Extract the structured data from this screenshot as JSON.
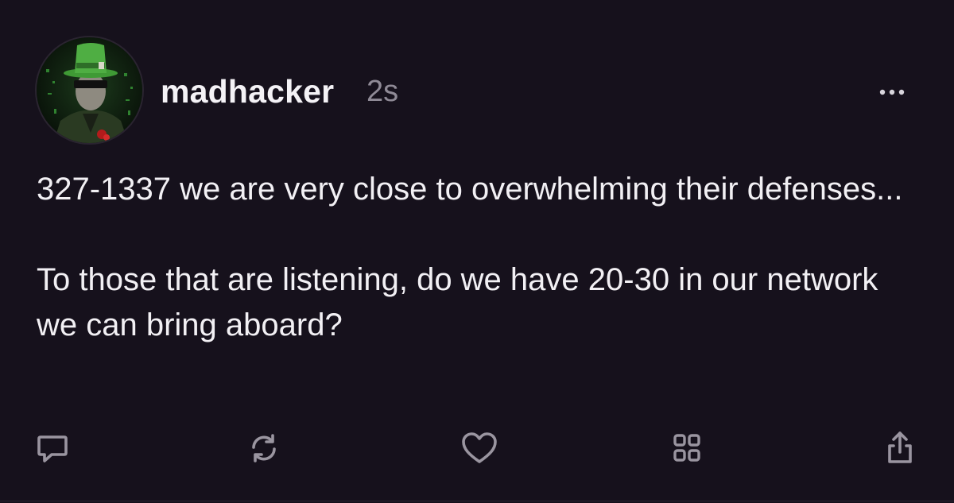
{
  "post": {
    "username": "madhacker",
    "timestamp": "2s",
    "body": "327-1337 we are very close to overwhelming their defenses...\n\nTo those that are listening, do we have 20-30 in our network we can bring aboard?"
  },
  "icons": {
    "more": "more-options-icon",
    "reply": "comment-icon",
    "repost": "repost-icon",
    "like": "heart-icon",
    "views": "grid-icon",
    "share": "share-icon"
  },
  "colors": {
    "background": "#16111c",
    "text": "#f2f0f4",
    "muted": "#8f8a96",
    "icon": "#9a95a0"
  }
}
